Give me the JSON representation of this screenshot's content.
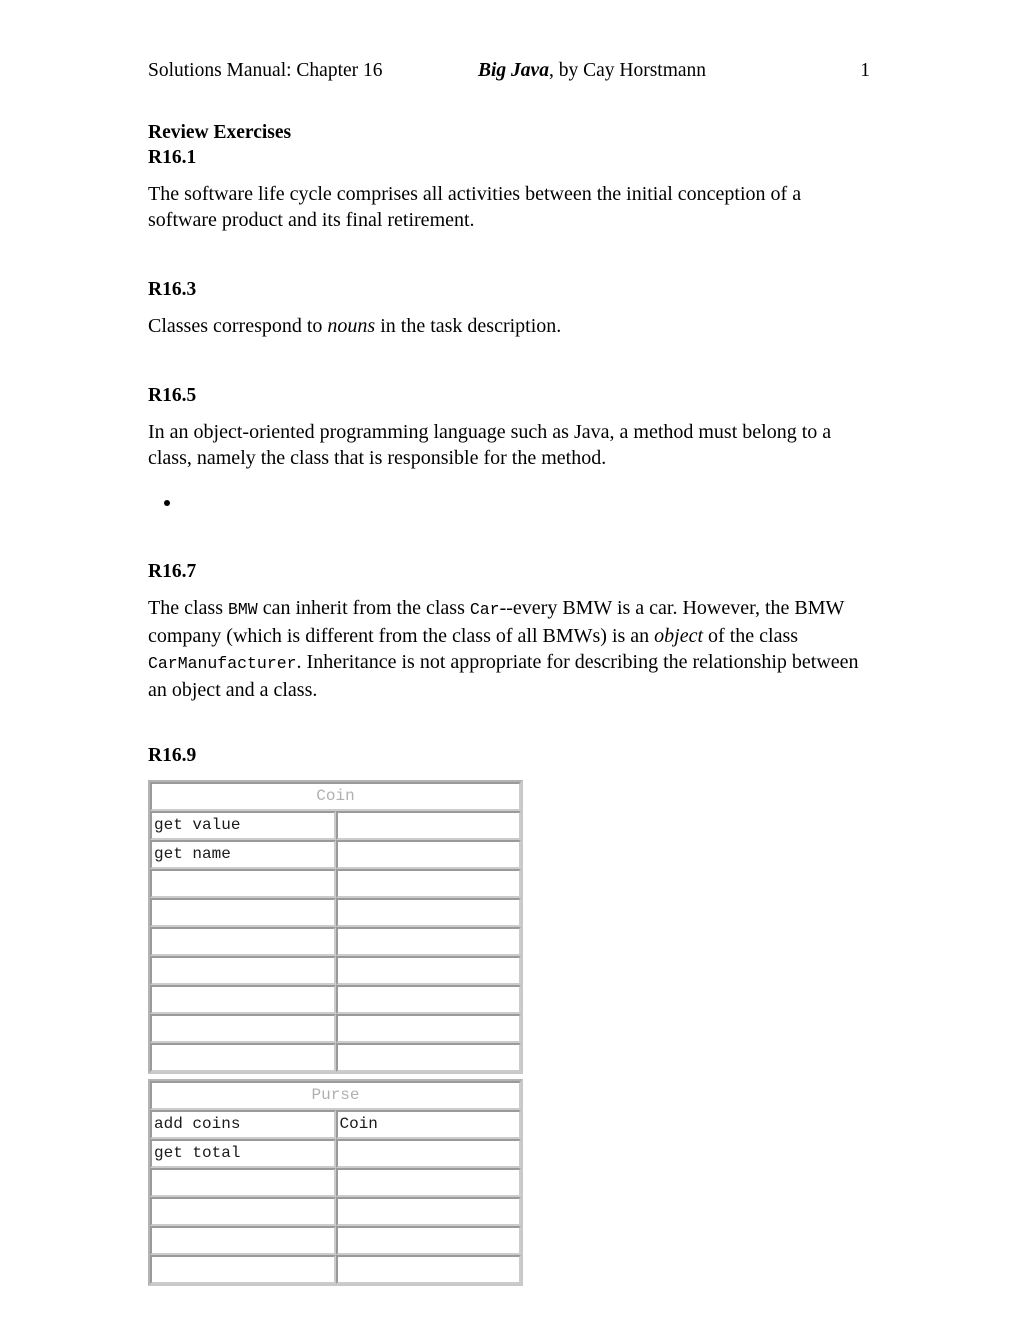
{
  "header": {
    "left": "Solutions Manual: Chapter 16",
    "center_book": "Big Java",
    "center_rest": ", by Cay Horstmann",
    "page_number": "1"
  },
  "document": {
    "section_title": "Review Exercises",
    "exercises": [
      {
        "id": "R16.1",
        "paragraphs": [
          {
            "runs": [
              {
                "text": "The software life cycle comprises all activities between the initial conception of a software product and its final retirement.",
                "style": "normal"
              }
            ]
          }
        ]
      },
      {
        "id": "R16.3",
        "paragraphs": [
          {
            "runs": [
              {
                "text": "Classes correspond to ",
                "style": "normal"
              },
              {
                "text": "nouns",
                "style": "italic"
              },
              {
                "text": " in the task description.",
                "style": "normal"
              }
            ]
          }
        ]
      },
      {
        "id": "R16.5",
        "paragraphs": [
          {
            "runs": [
              {
                "text": "In an object-oriented programming language such as Java, a method must belong to a class, namely the class that is responsible for the method.",
                "style": "normal"
              }
            ]
          }
        ],
        "bullets": [
          ""
        ]
      },
      {
        "id": "R16.7",
        "paragraphs": [
          {
            "runs": [
              {
                "text": "The class ",
                "style": "normal"
              },
              {
                "text": "BMW",
                "style": "mono"
              },
              {
                "text": " can inherit from the class ",
                "style": "normal"
              },
              {
                "text": "Car",
                "style": "mono"
              },
              {
                "text": "--every BMW is a car. However, the BMW company (which is different from the class of all BMWs) is an ",
                "style": "normal"
              },
              {
                "text": "object",
                "style": "italic"
              },
              {
                "text": " of the class ",
                "style": "normal"
              },
              {
                "text": "CarManufacturer",
                "style": "mono"
              },
              {
                "text": ". Inheritance is not appropriate for describing the relationship between an object and a class.",
                "style": "normal"
              }
            ]
          }
        ]
      },
      {
        "id": "R16.9",
        "paragraphs": [],
        "crc_cards": [
          {
            "title": "Coin",
            "rows": [
              {
                "responsibility": "get value",
                "collaborator": ""
              },
              {
                "responsibility": "get name",
                "collaborator": ""
              },
              {
                "responsibility": "",
                "collaborator": ""
              },
              {
                "responsibility": "",
                "collaborator": ""
              },
              {
                "responsibility": "",
                "collaborator": ""
              },
              {
                "responsibility": "",
                "collaborator": ""
              },
              {
                "responsibility": "",
                "collaborator": ""
              },
              {
                "responsibility": "",
                "collaborator": ""
              },
              {
                "responsibility": "",
                "collaborator": ""
              }
            ]
          },
          {
            "title": "Purse",
            "rows": [
              {
                "responsibility": "add coins",
                "collaborator": "Coin"
              },
              {
                "responsibility": "get total",
                "collaborator": ""
              },
              {
                "responsibility": "",
                "collaborator": ""
              },
              {
                "responsibility": "",
                "collaborator": ""
              },
              {
                "responsibility": "",
                "collaborator": ""
              },
              {
                "responsibility": "",
                "collaborator": ""
              }
            ]
          }
        ]
      }
    ]
  }
}
